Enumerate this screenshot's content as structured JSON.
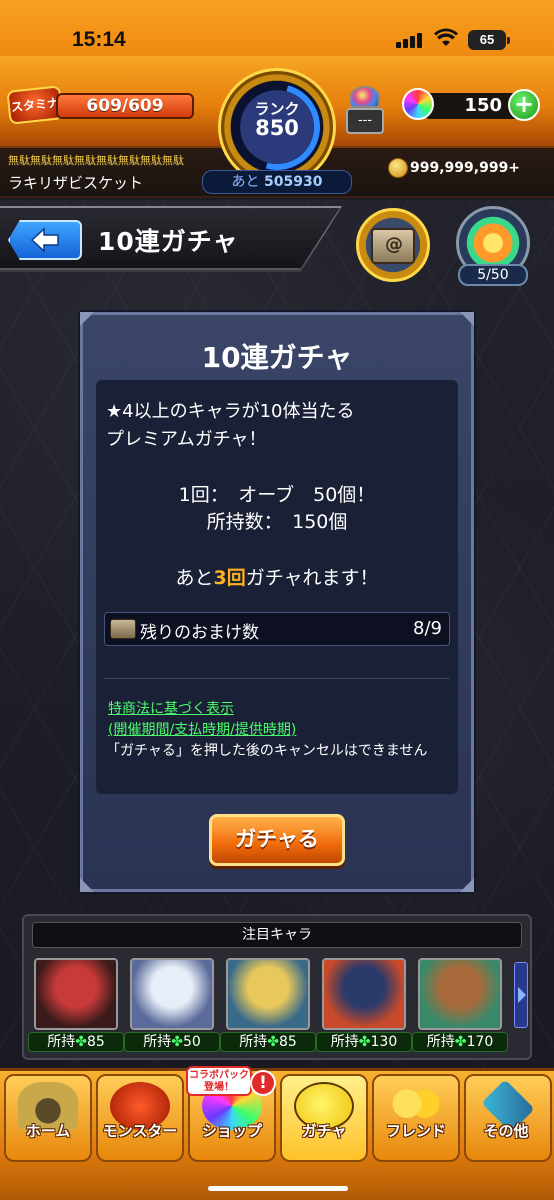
{
  "status_bar": {
    "time": "15:14",
    "battery": "65"
  },
  "header": {
    "stamina_label": "スタミナ",
    "stamina_value": "609/609",
    "rank_label": "ランク",
    "rank_value": "850",
    "rank_remaining_prefix": "あと",
    "rank_remaining_value": "505930",
    "machine_label": "---",
    "orb_count": "150",
    "title_scroll": "無駄無駄無駄無駄無駄無駄無駄無駄",
    "title_name": "ラキリザビスケット",
    "coin_count": "999,999,999+"
  },
  "nav": {
    "page_title": "10連ガチャ",
    "event_count": "5/50"
  },
  "gacha": {
    "title": "10連ガチャ",
    "description_line1": "★4以上のキャラが10体当たる",
    "description_line2": "プレミアムガチャ！",
    "cost": "1回：　オーブ　50個！",
    "owned": "所持数：　150個",
    "remaining_prefix": "あと",
    "remaining_num": "3回",
    "remaining_suffix": "ガチャれます！",
    "bonus_label": "残りのおまけ数",
    "bonus_count": "8/9",
    "legal_link_1": "特商法に基づく表示",
    "legal_link_2": "(開催期間/支払時期/提供時期)",
    "legal_note": "「ガチャる」を押した後のキャンセルはできません",
    "button_label": "ガチャる"
  },
  "featured": {
    "header": "注目キャラ",
    "owned_prefix": "所持",
    "clover": "✤",
    "characters": [
      {
        "owned": "85",
        "colors": [
          "#c83a3a",
          "#3a1a1a"
        ]
      },
      {
        "owned": "50",
        "colors": [
          "#e8eef8",
          "#5a6a9a"
        ]
      },
      {
        "owned": "85",
        "colors": [
          "#e8c85a",
          "#3a6a8a"
        ]
      },
      {
        "owned": "130",
        "colors": [
          "#2a3a6a",
          "#c84a2a"
        ]
      },
      {
        "owned": "170",
        "colors": [
          "#a86a3a",
          "#3a8a6a"
        ]
      }
    ]
  },
  "bottom_nav": {
    "home": "ホーム",
    "monster": "モンスター",
    "shop": "ショップ",
    "gacha": "ガチャ",
    "friend": "フレンド",
    "other": "その他",
    "collab_badge_line1": "コラボパック",
    "collab_badge_line2": "登場！",
    "alert": "!"
  }
}
